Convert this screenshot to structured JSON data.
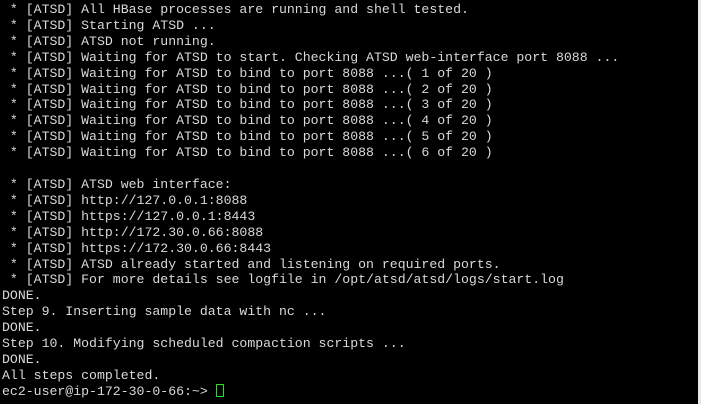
{
  "terminal": {
    "lines": [
      " * [ATSD] All HBase processes are running and shell tested.",
      " * [ATSD] Starting ATSD ...",
      " * [ATSD] ATSD not running.",
      " * [ATSD] Waiting for ATSD to start. Checking ATSD web-interface port 8088 ...",
      " * [ATSD] Waiting for ATSD to bind to port 8088 ...( 1 of 20 )",
      " * [ATSD] Waiting for ATSD to bind to port 8088 ...( 2 of 20 )",
      " * [ATSD] Waiting for ATSD to bind to port 8088 ...( 3 of 20 )",
      " * [ATSD] Waiting for ATSD to bind to port 8088 ...( 4 of 20 )",
      " * [ATSD] Waiting for ATSD to bind to port 8088 ...( 5 of 20 )",
      " * [ATSD] Waiting for ATSD to bind to port 8088 ...( 6 of 20 )",
      "",
      " * [ATSD] ATSD web interface:",
      " * [ATSD] http://127.0.0.1:8088",
      " * [ATSD] https://127.0.0.1:8443",
      " * [ATSD] http://172.30.0.66:8088",
      " * [ATSD] https://172.30.0.66:8443",
      " * [ATSD] ATSD already started and listening on required ports.",
      " * [ATSD] For more details see logfile in /opt/atsd/atsd/logs/start.log",
      "DONE.",
      "Step 9. Inserting sample data with nc ...",
      "DONE.",
      "Step 10. Modifying scheduled compaction scripts ...",
      "DONE.",
      "All steps completed."
    ],
    "prompt": "ec2-user@ip-172-30-0-66:~> ",
    "colors": {
      "background": "#000000",
      "text": "#d9d9d9",
      "cursor": "#22e022"
    }
  }
}
